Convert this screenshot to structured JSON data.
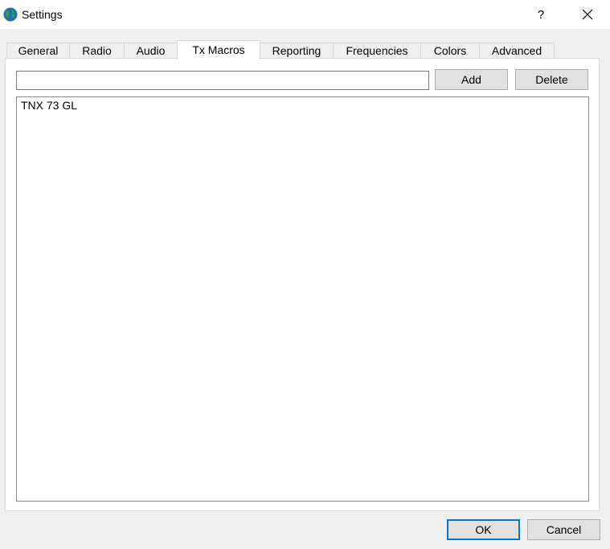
{
  "window": {
    "title": "Settings",
    "help_label": "?"
  },
  "tabs": [
    {
      "label": "General"
    },
    {
      "label": "Radio"
    },
    {
      "label": "Audio"
    },
    {
      "label": "Tx Macros",
      "active": true
    },
    {
      "label": "Reporting"
    },
    {
      "label": "Frequencies"
    },
    {
      "label": "Colors"
    },
    {
      "label": "Advanced"
    }
  ],
  "macros": {
    "input_value": "",
    "add_label": "Add",
    "delete_label": "Delete",
    "items": [
      "TNX 73 GL"
    ]
  },
  "footer": {
    "ok_label": "OK",
    "cancel_label": "Cancel",
    "ok_focus_color": "#0078d7"
  }
}
